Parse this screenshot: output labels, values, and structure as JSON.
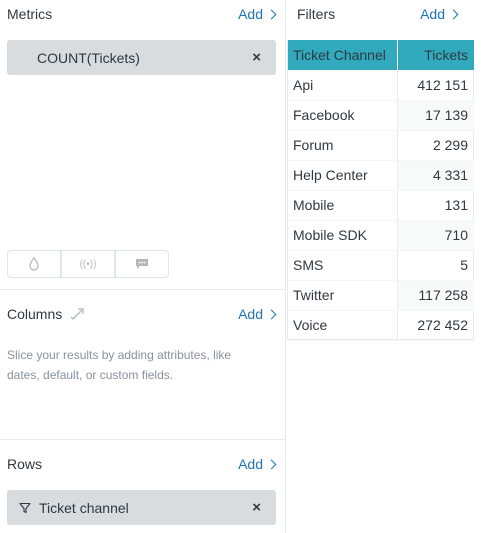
{
  "metrics": {
    "title": "Metrics",
    "add_label": "Add",
    "items": [
      {
        "label": "COUNT(Tickets)",
        "remove": "×"
      }
    ]
  },
  "visualization_buttons": [
    {
      "icon": "droplet-icon"
    },
    {
      "icon": "broadcast-icon",
      "label": "((•))"
    },
    {
      "icon": "comment-icon"
    }
  ],
  "columns": {
    "title": "Columns",
    "icon": "swap-icon",
    "add_label": "Add",
    "hint": "Slice your results by adding attributes, like dates, default, or custom fields."
  },
  "rows": {
    "title": "Rows",
    "add_label": "Add",
    "items": [
      {
        "label": "Ticket channel",
        "icon": "filter-icon",
        "remove": "×"
      }
    ]
  },
  "filters": {
    "title": "Filters",
    "add_label": "Add"
  },
  "table": {
    "header_color": "#30aabc",
    "headers": [
      "Ticket Channel",
      "Tickets"
    ],
    "rows": [
      [
        "Api",
        "412 151"
      ],
      [
        "Facebook",
        "17 139"
      ],
      [
        "Forum",
        "2 299"
      ],
      [
        "Help Center",
        "4 331"
      ],
      [
        "Mobile",
        "131"
      ],
      [
        "Mobile SDK",
        "710"
      ],
      [
        "SMS",
        "5"
      ],
      [
        "Twitter",
        "117 258"
      ],
      [
        "Voice",
        "272 452"
      ]
    ]
  }
}
